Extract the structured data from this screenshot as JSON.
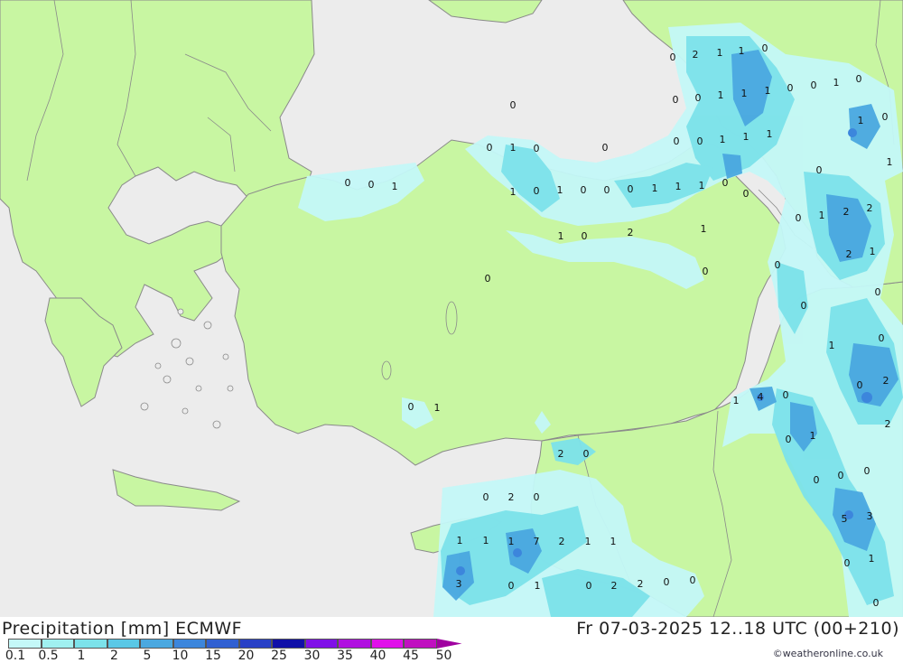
{
  "header": {
    "title": "Precipitation [mm] ECMWF",
    "run": "Fr 07-03-2025 12..18 UTC (00+210)",
    "credit": "©weatheronline.co.uk"
  },
  "colors": {
    "sea": "#ececec",
    "land": "#c8f6a2",
    "border": "#8a8a8a"
  },
  "legend": {
    "labels": [
      "0.1",
      "0.5",
      "1",
      "2",
      "5",
      "10",
      "15",
      "20",
      "25",
      "30",
      "35",
      "40",
      "45",
      "50"
    ],
    "colors": [
      "#c4f8f8",
      "#a0f0f0",
      "#7ce2ea",
      "#5ac8e6",
      "#4aa8e0",
      "#3c86dc",
      "#3060d2",
      "#2840c6",
      "#1010a8",
      "#8010e8",
      "#b010e0",
      "#e010ea",
      "#c010c0",
      "#a000a0"
    ]
  },
  "values": [
    {
      "v": "0"
    },
    {
      "v": "2"
    },
    {
      "v": "1"
    },
    {
      "v": "1"
    },
    {
      "v": "0"
    },
    {
      "v": "0"
    },
    {
      "v": "0"
    },
    {
      "v": "1"
    },
    {
      "v": "1"
    },
    {
      "v": "1"
    },
    {
      "v": "0"
    },
    {
      "v": "0"
    },
    {
      "v": "1"
    },
    {
      "v": "0"
    },
    {
      "v": "0"
    },
    {
      "v": "1"
    },
    {
      "v": "0"
    },
    {
      "v": "0"
    },
    {
      "v": "1"
    },
    {
      "v": "0"
    },
    {
      "v": "0"
    },
    {
      "v": "0"
    },
    {
      "v": "0"
    },
    {
      "v": "1"
    },
    {
      "v": "1"
    },
    {
      "v": "1"
    },
    {
      "v": "1"
    },
    {
      "v": "0"
    },
    {
      "v": "0"
    },
    {
      "v": "0"
    },
    {
      "v": "1"
    },
    {
      "v": "1"
    },
    {
      "v": "0"
    },
    {
      "v": "1"
    },
    {
      "v": "0"
    },
    {
      "v": "0"
    },
    {
      "v": "0"
    },
    {
      "v": "1"
    },
    {
      "v": "1"
    },
    {
      "v": "1"
    },
    {
      "v": "0"
    },
    {
      "v": "0"
    },
    {
      "v": "0"
    },
    {
      "v": "1"
    },
    {
      "v": "2"
    },
    {
      "v": "2"
    },
    {
      "v": "1"
    },
    {
      "v": "0"
    },
    {
      "v": "2"
    },
    {
      "v": "1"
    },
    {
      "v": "2"
    },
    {
      "v": "1"
    },
    {
      "v": "0"
    },
    {
      "v": "0"
    },
    {
      "v": "0"
    },
    {
      "v": "0"
    },
    {
      "v": "1"
    },
    {
      "v": "0"
    },
    {
      "v": "0"
    },
    {
      "v": "0"
    },
    {
      "v": "1"
    },
    {
      "v": "4"
    },
    {
      "v": "0"
    },
    {
      "v": "0"
    },
    {
      "v": "1"
    },
    {
      "v": "2"
    },
    {
      "v": "0"
    },
    {
      "v": "1"
    },
    {
      "v": "2"
    },
    {
      "v": "2"
    },
    {
      "v": "0"
    },
    {
      "v": "0"
    },
    {
      "v": "0"
    },
    {
      "v": "0"
    },
    {
      "v": "0"
    },
    {
      "v": "2"
    },
    {
      "v": "0"
    },
    {
      "v": "5"
    },
    {
      "v": "3"
    },
    {
      "v": "1"
    },
    {
      "v": "1"
    },
    {
      "v": "1"
    },
    {
      "v": "7"
    },
    {
      "v": "2"
    },
    {
      "v": "1"
    },
    {
      "v": "1"
    },
    {
      "v": "0"
    },
    {
      "v": "1"
    },
    {
      "v": "3"
    },
    {
      "v": "0"
    },
    {
      "v": "1"
    },
    {
      "v": "0"
    },
    {
      "v": "2"
    },
    {
      "v": "2"
    },
    {
      "v": "0"
    },
    {
      "v": "0"
    },
    {
      "v": "0"
    }
  ]
}
